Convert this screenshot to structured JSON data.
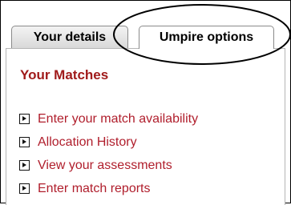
{
  "tabs": [
    {
      "label": "Your details"
    },
    {
      "label": "Umpire options"
    }
  ],
  "panel": {
    "heading": "Your Matches",
    "links": [
      {
        "label": "Enter your match availability",
        "icon": "bullet-arrow-icon"
      },
      {
        "label": "Allocation History",
        "icon": "bullet-arrow-icon"
      },
      {
        "label": "View your assessments",
        "icon": "bullet-arrow-icon"
      },
      {
        "label": "Enter match reports",
        "icon": "bullet-arrow-icon"
      }
    ]
  },
  "colors": {
    "heading": "#a01b1b",
    "link": "#b01e2c"
  }
}
